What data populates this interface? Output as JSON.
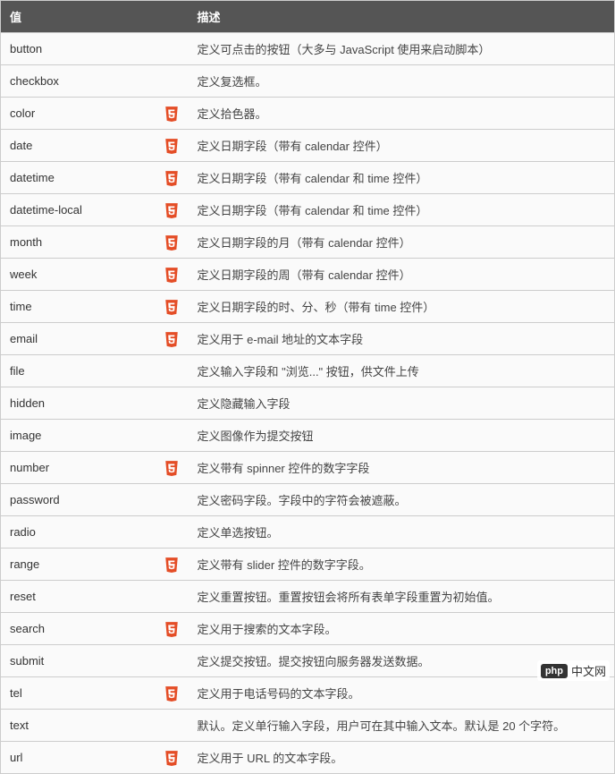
{
  "headers": {
    "value": "值",
    "description": "描述"
  },
  "rows": [
    {
      "value": "button",
      "html5": false,
      "description": "定义可点击的按钮（大多与 JavaScript 使用来启动脚本）"
    },
    {
      "value": "checkbox",
      "html5": false,
      "description": "定义复选框。"
    },
    {
      "value": "color",
      "html5": true,
      "description": "定义拾色器。"
    },
    {
      "value": "date",
      "html5": true,
      "description": "定义日期字段（带有 calendar 控件）"
    },
    {
      "value": "datetime",
      "html5": true,
      "description": "定义日期字段（带有 calendar 和 time 控件）"
    },
    {
      "value": "datetime-local",
      "html5": true,
      "description": "定义日期字段（带有 calendar 和 time 控件）"
    },
    {
      "value": "month",
      "html5": true,
      "description": "定义日期字段的月（带有 calendar 控件）"
    },
    {
      "value": "week",
      "html5": true,
      "description": "定义日期字段的周（带有 calendar 控件）"
    },
    {
      "value": "time",
      "html5": true,
      "description": "定义日期字段的时、分、秒（带有 time 控件）"
    },
    {
      "value": "email",
      "html5": true,
      "description": "定义用于 e-mail 地址的文本字段"
    },
    {
      "value": "file",
      "html5": false,
      "description": "定义输入字段和 \"浏览...\" 按钮，供文件上传"
    },
    {
      "value": "hidden",
      "html5": false,
      "description": "定义隐藏输入字段"
    },
    {
      "value": "image",
      "html5": false,
      "description": "定义图像作为提交按钮"
    },
    {
      "value": "number",
      "html5": true,
      "description": "定义带有 spinner 控件的数字字段"
    },
    {
      "value": "password",
      "html5": false,
      "description": "定义密码字段。字段中的字符会被遮蔽。"
    },
    {
      "value": "radio",
      "html5": false,
      "description": "定义单选按钮。"
    },
    {
      "value": "range",
      "html5": true,
      "description": "定义带有 slider 控件的数字字段。"
    },
    {
      "value": "reset",
      "html5": false,
      "description": "定义重置按钮。重置按钮会将所有表单字段重置为初始值。"
    },
    {
      "value": "search",
      "html5": true,
      "description": "定义用于搜索的文本字段。"
    },
    {
      "value": "submit",
      "html5": false,
      "description": "定义提交按钮。提交按钮向服务器发送数据。"
    },
    {
      "value": "tel",
      "html5": true,
      "description": "定义用于电话号码的文本字段。"
    },
    {
      "value": "text",
      "html5": false,
      "description": "默认。定义单行输入字段，用户可在其中输入文本。默认是 20 个字符。"
    },
    {
      "value": "url",
      "html5": true,
      "description": "定义用于 URL 的文本字段。"
    }
  ],
  "watermark": {
    "badge": "php",
    "text": "中文网"
  }
}
